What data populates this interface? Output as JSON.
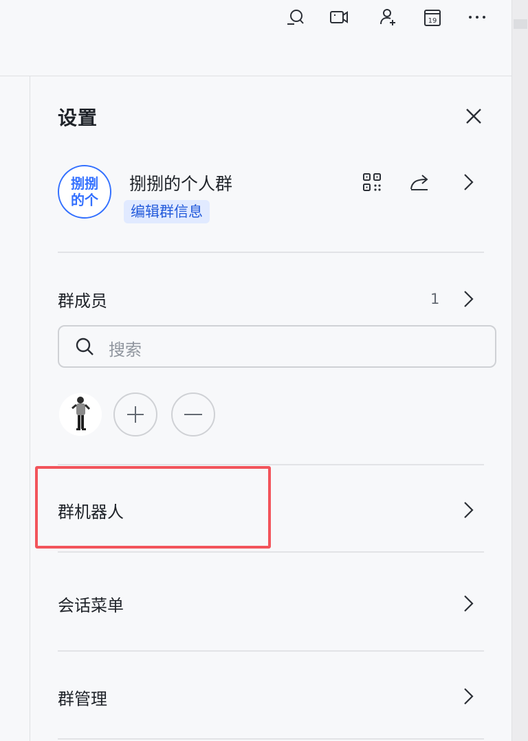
{
  "toolbar": {
    "icons": [
      "search-chat-icon",
      "video-icon",
      "add-member-icon",
      "calendar-icon",
      "more-icon"
    ],
    "calendar_day": "19"
  },
  "settings": {
    "title": "设置",
    "group": {
      "avatar_line1": "捌捌",
      "avatar_line2": "的个",
      "name": "捌捌的个人群",
      "edit_label": "编辑群信息"
    },
    "members": {
      "label": "群成员",
      "count": "1",
      "search_placeholder": "搜索"
    },
    "rows": {
      "bots": "群机器人",
      "menu": "会话菜单",
      "manage": "群管理"
    }
  },
  "colors": {
    "accent": "#3370ff",
    "highlight": "#f2545b",
    "badge_bg": "#e1eaff"
  }
}
